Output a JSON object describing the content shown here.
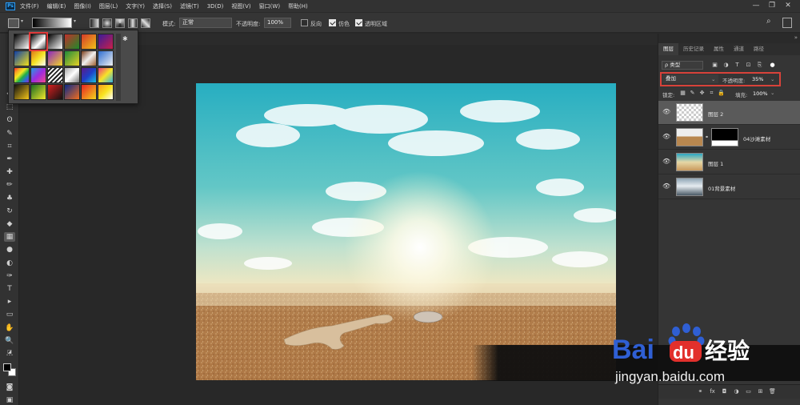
{
  "menu": {
    "items": [
      "文件(F)",
      "编辑(E)",
      "图像(I)",
      "图层(L)",
      "文字(Y)",
      "选择(S)",
      "滤镜(T)",
      "3D(D)",
      "视图(V)",
      "窗口(W)",
      "帮助(H)"
    ]
  },
  "app": {
    "logo": "Ps"
  },
  "window_controls": {
    "minimize": "—",
    "restore": "❐",
    "close": "✕"
  },
  "options_bar": {
    "mode_label": "模式:",
    "mode_value": "正常",
    "opacity_label": "不透明度:",
    "opacity_value": "100%",
    "reverse_label": "反向",
    "reverse_checked": false,
    "dither_label": "仿色",
    "dither_checked": true,
    "transparency_label": "透明区域",
    "transparency_checked": true
  },
  "gradient_picker": {
    "selected_index": 1,
    "presets": [
      "linear-gradient(135deg,#000,#fff)",
      "linear-gradient(135deg,#000 0%,#fff 60%,rgba(255,255,255,0) 100%)",
      "linear-gradient(135deg,#000,#fff)",
      "linear-gradient(135deg,#c0302b,#1f8a2a)",
      "linear-gradient(135deg,#d43a2a,#f2c318)",
      "linear-gradient(135deg,#3a1b9a,#c9204a)",
      "linear-gradient(135deg,#0d3ea8,#f2e11a)",
      "linear-gradient(135deg,#e07718,#f4e324,#fff)",
      "linear-gradient(135deg,#8d26c1,#f2d625)",
      "linear-gradient(135deg,#1e8a3a,#e6d225)",
      "linear-gradient(135deg,#7a3d1a,#f0f0f0,#a06030)",
      "linear-gradient(135deg,#2f6fd1,#f0f0f0)",
      "linear-gradient(135deg,#f12a2a,#f7a124,#f2ea21,#21b046,#2d6cd8,#8a2ec9)",
      "linear-gradient(135deg,#1ea0e0,#9d2be0,#f24a8c)",
      "repeating-linear-gradient(135deg,#fff 0 2px,#222 2px 4px)",
      "linear-gradient(135deg,#a6a6a6,#ffffff,#7a7a7a)",
      "linear-gradient(135deg,#5a1b8a,#1e3fc8,#1ac1e0)",
      "linear-gradient(135deg,#ec3a7a,#f6e428,#32b4e6)",
      "linear-gradient(135deg,#111,#f4c518)",
      "linear-gradient(135deg,#1a6b22,#f2e82c)",
      "linear-gradient(135deg,#d42020,#111)",
      "linear-gradient(135deg,#0a2a8a,#f26d1d)",
      "linear-gradient(135deg,#e72323,#f5d51c)",
      "linear-gradient(135deg,#f79b1b,#f8e31f,#fff)"
    ]
  },
  "tools": {
    "icons": [
      "move-icon",
      "marquee-icon",
      "lasso-icon",
      "quick-select-icon",
      "crop-icon",
      "eyedropper-icon",
      "heal-icon",
      "brush-icon",
      "stamp-icon",
      "history-brush-icon",
      "eraser-icon",
      "gradient-icon",
      "blur-icon",
      "dodge-icon",
      "pen-icon",
      "type-icon",
      "path-select-icon",
      "rectangle-icon",
      "hand-icon",
      "zoom-icon",
      "more-icon"
    ],
    "glyphs": [
      "✥",
      "⬚",
      "ʘ",
      "✎",
      "⌗",
      "✒",
      "✚",
      "✏",
      "♣",
      "↻",
      "◆",
      "▦",
      "●",
      "◐",
      "✑",
      "T",
      "▸",
      "▭",
      "✋",
      "🔍",
      "…"
    ]
  },
  "layers_panel": {
    "tabs": [
      "图层",
      "历史记录",
      "属性",
      "通道",
      "路径"
    ],
    "filter_label": "ρ 类型",
    "blend_mode": "叠加",
    "opacity_label": "不透明度:",
    "opacity_value": "35%",
    "lock_label": "锁定:",
    "fill_label": "填充:",
    "fill_value": "100%",
    "layers": [
      {
        "name": "图层 2",
        "selected": true,
        "thumb": "transparent"
      },
      {
        "name": "04沙滩素材",
        "selected": false,
        "thumb": "sand",
        "has_mask": true
      },
      {
        "name": "图层 1",
        "selected": false,
        "thumb": "gradient"
      },
      {
        "name": "01背景素材",
        "selected": false,
        "thumb": "sky"
      }
    ],
    "footer_icons": [
      "link-icon",
      "fx-icon",
      "mask-icon",
      "adjustment-icon",
      "group-icon",
      "new-layer-icon",
      "delete-icon"
    ],
    "footer_glyphs": [
      "⚭",
      "fx",
      "◘",
      "◑",
      "▭",
      "⊞",
      "🗑"
    ]
  },
  "watermark": {
    "brand": "Bai",
    "brand2": "du",
    "cn": "经验",
    "url": "jingyan.baidu.com"
  },
  "colors": {
    "selection_highlight": "#d8423a",
    "watermark_blue": "#2f5fd4",
    "watermark_red": "#e2302c"
  }
}
